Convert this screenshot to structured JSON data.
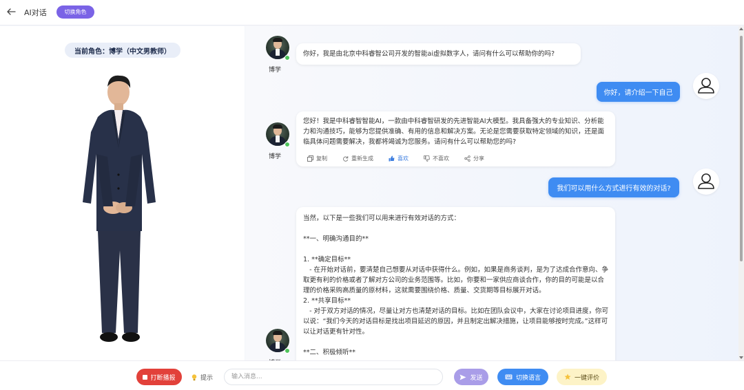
{
  "header": {
    "title": "AI对话",
    "switch_role_label": "切换角色"
  },
  "left_panel": {
    "current_role": "当前角色：博学（中文男教师）"
  },
  "messages": [
    {
      "role": "ai",
      "name": "博学",
      "text": "你好，我是由北京中科睿智公司开发的智能ai虚拟数字人，请问有什么可以帮助你的吗?"
    },
    {
      "role": "user",
      "text": "你好，请介绍一下自己"
    },
    {
      "role": "ai",
      "name": "博学",
      "text": "您好！我是中科睿智智能AI，一款由中科睿智研发的先进智能AI大模型。我具备强大的专业知识、分析能力和沟通技巧，能够为您提供准确、有用的信息和解决方案。无论是您需要获取特定领域的知识，还是面临具体问题需要解决，我都将竭诚为您服务。请问有什么可以帮助您的吗?",
      "actions": [
        "复制",
        "重新生成",
        "喜欢",
        "不喜欢",
        "分享"
      ]
    },
    {
      "role": "user",
      "text": "我们可以用什么方式进行有效的对话?"
    },
    {
      "role": "ai",
      "name": "博学",
      "text": "当然，以下是一些我们可以用来进行有效对话的方式：\n\n**一、明确沟通目的**\n\n1. **确定目标**\n   - 在开始对话前，要清楚自己想要从对话中获得什么。例如，如果是商务谈判，是为了达成合作意向、争取更有利的价格或者了解对方公司的业务范围等。比如，你要和一家供应商谈合作，你的目的可能是以合理的价格采购高质量的原材料，这就需要围绕价格、质量、交货期等目标展开对话。\n2. **共享目标**\n   - 对于双方对话的情况，尽量让对方也清楚对话的目标。比如在团队会议中，大家在讨论项目进度，你可以说：“我们今天的对话目标是找出项目延迟的原因，并且制定出解决措施，让项目能够按时完成。”这样可以让对话更有针对性。\n\n**二、积极倾听**"
    }
  ],
  "bottom": {
    "stop_label": "打断播报",
    "hint_label": "提示",
    "input_placeholder": "输入消息...",
    "input_value": "",
    "send_label": "发送",
    "voice_label": "切换语言",
    "rate_label": "一键评价"
  },
  "colors": {
    "accent": "#7a63e6",
    "user_bubble": "#3f8cf2",
    "stop": "#e2413a",
    "online": "#4fc35c"
  }
}
